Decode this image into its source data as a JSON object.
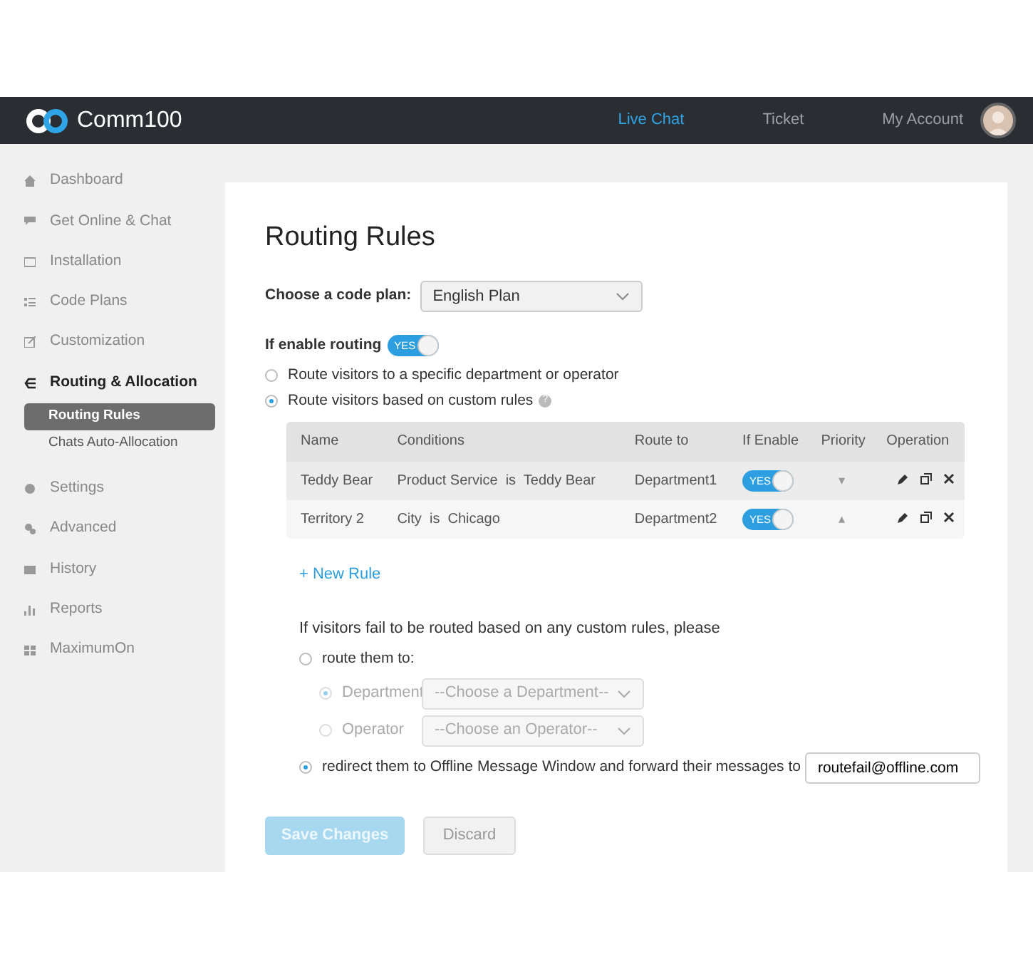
{
  "navbar": {
    "brand": "Comm100",
    "tabs": [
      {
        "label": "Live Chat",
        "selected": true
      },
      {
        "label": "Ticket",
        "selected": false
      },
      {
        "label": "My Account",
        "selected": false
      }
    ]
  },
  "sidebar": {
    "items": [
      {
        "label": "Dashboard",
        "selected": false
      },
      {
        "label": "Get Online & Chat",
        "selected": false
      },
      {
        "label": "Installation",
        "selected": false
      },
      {
        "label": "Code Plans",
        "selected": false
      },
      {
        "label": "Customization",
        "selected": false
      },
      {
        "label": "Routing & Allocation",
        "selected": true,
        "children": [
          {
            "label": "Routing Rules",
            "selected": true
          },
          {
            "label": "Chats Auto-Allocation",
            "selected": false
          }
        ]
      },
      {
        "label": "Settings",
        "selected": false
      },
      {
        "label": "Advanced",
        "selected": false
      },
      {
        "label": "History",
        "selected": false
      },
      {
        "label": "Reports",
        "selected": false
      },
      {
        "label": "MaximumOn",
        "selected": false
      }
    ]
  },
  "page": {
    "title": "Routing Rules",
    "code_plan": {
      "label": "Choose a code plan:",
      "value": "English Plan"
    },
    "enable_routing": {
      "label": "If enable routing",
      "toggle": "YES",
      "on": true
    },
    "route_options": [
      {
        "label": "Route visitors to a specific department or operator",
        "selected": false
      },
      {
        "label": "Route visitors based on custom rules",
        "selected": true,
        "help": "?"
      }
    ],
    "table": {
      "columns": [
        "Name",
        "Conditions",
        "Route to",
        "If Enable",
        "Priority",
        "Operation"
      ],
      "rows": [
        {
          "name": "Teddy Bear",
          "conditions": "Product Service  is  Teddy Bear",
          "route_to": "Department1",
          "toggle": "YES",
          "on": true,
          "priority": "▾"
        },
        {
          "name": "Territory 2",
          "conditions": "City  is  Chicago",
          "route_to": "Department2",
          "toggle": "YES",
          "on": true,
          "priority": "▴"
        }
      ]
    },
    "new_rule": "+ New Rule",
    "fallback": {
      "intro": "If visitors fail to be routed based on any custom rules, please",
      "route_them": {
        "label": "route them to:",
        "selected": false,
        "targets": [
          {
            "label": "Department",
            "placeholder": "--Choose a Department--",
            "selected": true,
            "disabled": true
          },
          {
            "label": "Operator",
            "placeholder": "--Choose an Operator--",
            "selected": false,
            "disabled": true
          }
        ]
      },
      "redirect": {
        "label": "redirect them to Offline Message Window and forward their messages to",
        "selected": true,
        "email": "routefail@offline.com"
      }
    },
    "buttons": [
      {
        "label": "Save Changes",
        "kind": "primary",
        "disabled": true
      },
      {
        "label": "Discard",
        "kind": "secondary",
        "disabled": false
      }
    ]
  }
}
